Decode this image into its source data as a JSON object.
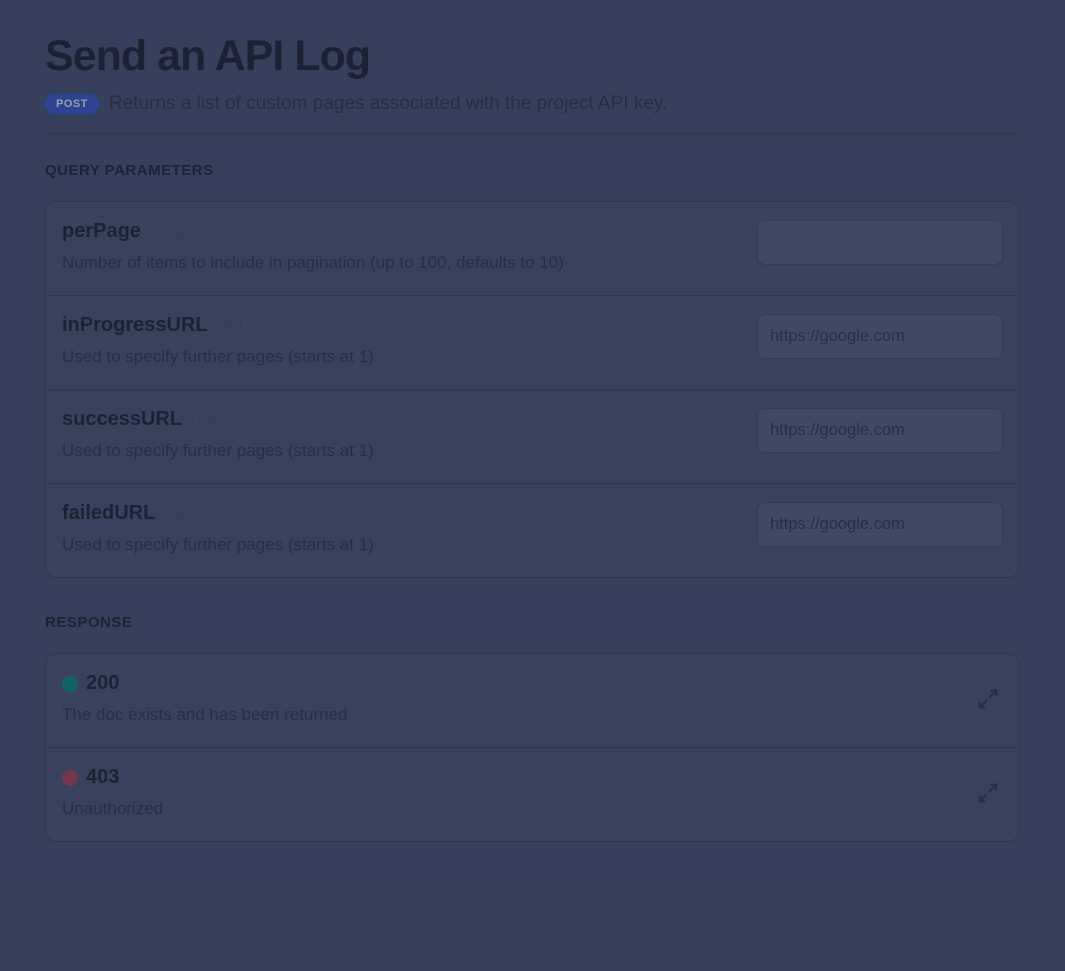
{
  "header": {
    "title": "Send an API Log",
    "method": "POST",
    "subtitle": "Returns a list of custom pages associated with the project API key."
  },
  "sections": {
    "query_params_heading": "QUERY PARAMETERS",
    "response_heading": "RESPONSE"
  },
  "params": [
    {
      "name": "perPage",
      "type": "integer",
      "desc": "Number of items to include in pagination (up to 100, defaults to 10)",
      "value": ""
    },
    {
      "name": "inProgressURL",
      "type": "URL",
      "desc": "Used to specify further pages (starts at 1)",
      "value": "https://google.com"
    },
    {
      "name": "successURL",
      "type": "URL",
      "desc": "Used to specify further pages (starts at 1)",
      "value": "https://google.com"
    },
    {
      "name": "failedURL",
      "type": "URL",
      "desc": "Used to specify further pages (starts at 1)",
      "value": "https://google.com"
    }
  ],
  "responses": [
    {
      "code": "200",
      "status": "success",
      "desc": "The doc exists and has been returned"
    },
    {
      "code": "403",
      "status": "error",
      "desc": "Unauthorized"
    }
  ]
}
